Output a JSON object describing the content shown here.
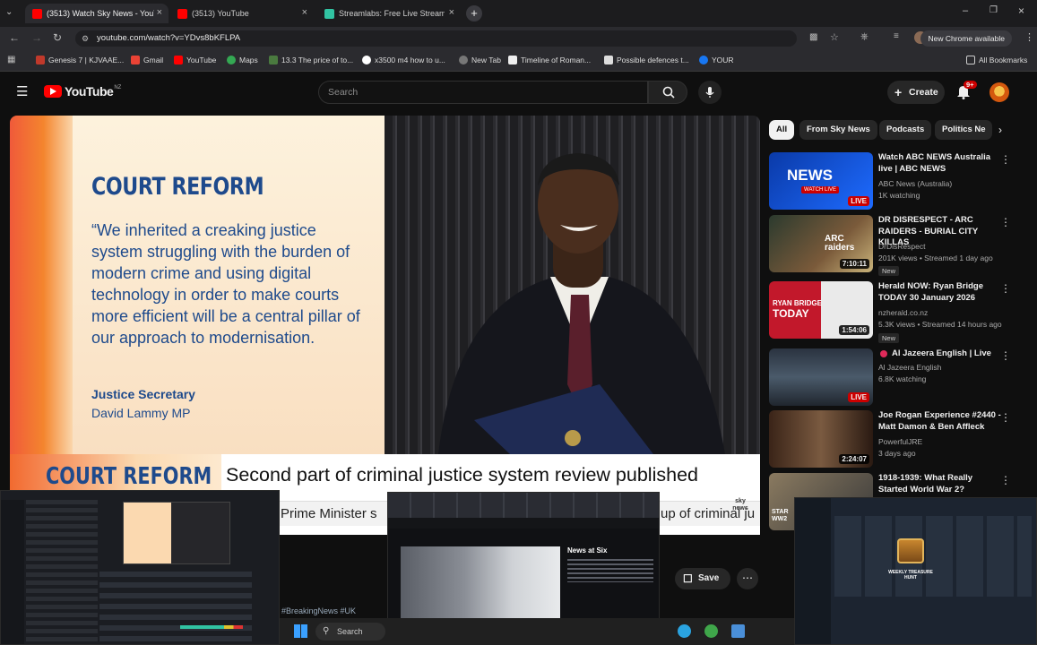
{
  "browser": {
    "tabs": [
      {
        "label": "(3513) Watch Sky News - YouTube",
        "active": true
      },
      {
        "label": "(3513) YouTube",
        "active": false
      },
      {
        "label": "Streamlabs: Free Live Stream",
        "active": false
      }
    ],
    "url": "youtube.com/watch?v=YDvs8bKFLPA",
    "new_chrome_label": "New Chrome available",
    "bookmarks": [
      "Genesis 7 | KJVAAE...",
      "Gmail",
      "YouTube",
      "Maps",
      "13.3 The price of to...",
      "x3500 m4 how to u...",
      "New Tab",
      "Timeline of Roman...",
      "Possible defences t...",
      "YOUR"
    ],
    "all_bookmarks_label": "All Bookmarks"
  },
  "youtube": {
    "logo_text": "YouTube",
    "logo_region": "NZ",
    "search_placeholder": "Search",
    "create_label": "Create",
    "notification_count": "9+"
  },
  "video": {
    "slide_heading": "COURT REFORM",
    "slide_quote": "“We inherited a creaking justice system struggling with the burden of modern crime and using digital technology in order to make courts more efficient will be a central pillar of our approach to modernisation.",
    "slide_role": "Justice Secretary",
    "slide_name": "David Lammy MP",
    "lower_tag": "COURT REFORM",
    "headline": "Second part of criminal justice system review published",
    "ticker_left": "Prime Minister s",
    "ticker_right": "up of criminal ju",
    "broadcaster": "sky news",
    "save_label": "Save",
    "hashtags": "#BreakingNews #UK"
  },
  "sidebar": {
    "chips": [
      "All",
      "From Sky News",
      "Podcasts",
      "Politics Ne"
    ],
    "recommendations": [
      {
        "title": "Watch ABC NEWS Australia live | ABC NEWS",
        "channel": "ABC News (Australia)",
        "meta": "1K watching",
        "badge": "LIVE",
        "new": "",
        "thumb_text": "NEWS",
        "thumb_sub": "WATCH LIVE"
      },
      {
        "title": "DR DISRESPECT - ARC RAIDERS - BURIAL CITY KILLAS",
        "channel": "DrDisRespect",
        "meta": "201K views • Streamed 1 day ago",
        "badge": "7:10:11",
        "new": "New",
        "thumb_text": "ARC raiders",
        "thumb_sub": ""
      },
      {
        "title": "Herald NOW: Ryan Bridge TODAY 30 January 2026",
        "channel": "nzherald.co.nz",
        "meta": "5.3K views • Streamed 14 hours ago",
        "badge": "1:54:06",
        "new": "New",
        "thumb_text": "RYAN BRIDGE",
        "thumb_sub": "TODAY"
      },
      {
        "title": "Al Jazeera English | Live",
        "channel": "Al Jazeera English",
        "meta": "6.8K watching",
        "badge": "LIVE",
        "new": "",
        "thumb_text": "",
        "thumb_sub": ""
      },
      {
        "title": "Joe Rogan Experience #2440 - Matt Damon & Ben Affleck",
        "channel": "PowerfulJRE",
        "meta": "3 days ago",
        "badge": "2:24:07",
        "new": "",
        "thumb_text": "",
        "thumb_sub": ""
      },
      {
        "title": "1918-1939: What Really Started World War 2?",
        "channel": "",
        "meta": "",
        "badge": "",
        "new": "",
        "thumb_text": "STAR WW2",
        "thumb_sub": ""
      }
    ]
  },
  "overlay": {
    "nested_site_title": "News at Six",
    "treasure_label": "WEEKLY TREASURE HUNT"
  },
  "taskbar": {
    "search_label": "Search"
  }
}
